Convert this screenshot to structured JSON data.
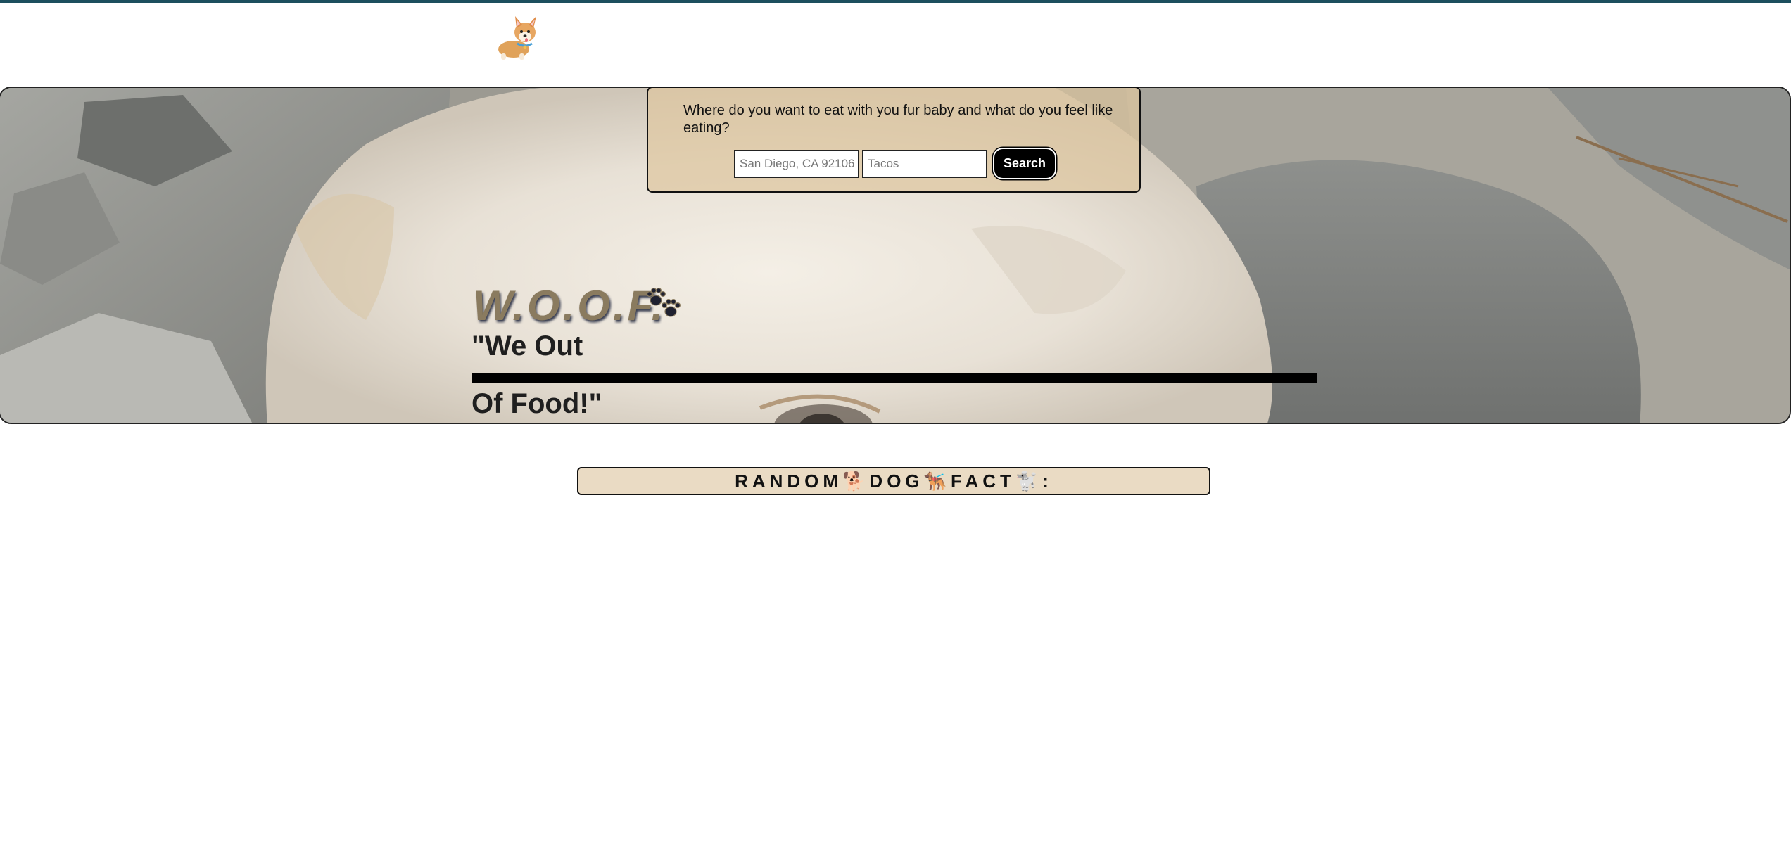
{
  "header": {
    "logo_icon": "corgi-logo-icon"
  },
  "hero": {
    "background": "photo-of-white-dog-on-rocks",
    "search": {
      "prompt": "Where do you want to eat with you fur baby and what do you feel like eating?",
      "location_placeholder": "San Diego, CA 92106",
      "food_placeholder": "Tacos",
      "button_label": "Search"
    },
    "brand": "W.O.O.F.",
    "brand_icon": "paw-prints-icon",
    "tagline_line1": "\"We Out",
    "tagline_line2": "Of Food!\""
  },
  "fact": {
    "title": "RANDOM🐕DOG🐕‍🦺FACT🐩:"
  },
  "colors": {
    "top_border": "#1d4f5e",
    "panel": "#dec6a0",
    "fact_bar": "#eadbc4",
    "brand_text": "#8a7b5f"
  }
}
